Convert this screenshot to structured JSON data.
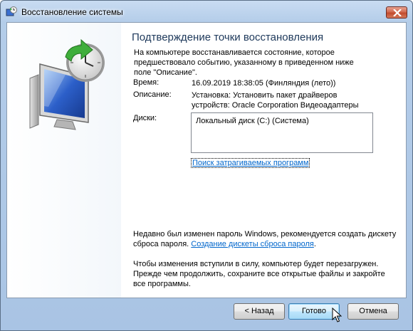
{
  "window": {
    "title": "Восстановление системы",
    "close_icon": "close-icon"
  },
  "page": {
    "heading": "Подтверждение точки восстановления",
    "intro": "На компьютере восстанавливается состояние, которое предшествовало событию, указанному в приведенном ниже поле \"Описание\"."
  },
  "details": {
    "time_label": "Время:",
    "time_value": "16.09.2019 18:38:05 (Финляндия (лето))",
    "desc_label": "Описание:",
    "desc_value_line1": "Установка: Установить пакет драйверов",
    "desc_value_line2": "устройств: Oracle Corporation Видеоадаптеры",
    "disks_label": "Диски:",
    "disks": [
      "Локальный диск (C:) (Система)"
    ],
    "scan_link": "Поиск затрагиваемых программ"
  },
  "password_note": {
    "text": "Недавно был изменен пароль Windows, рекомендуется создать дискету сброса пароля. ",
    "link": "Создание дискеты сброса пароля",
    "after": "."
  },
  "restart_note": "Чтобы изменения вступили в силу, компьютер будет перезагружен. Прежде чем продолжить, сохраните все открытые файлы и закройте все программы.",
  "buttons": {
    "back": "< Назад",
    "finish": "Готово",
    "cancel": "Отмена"
  }
}
